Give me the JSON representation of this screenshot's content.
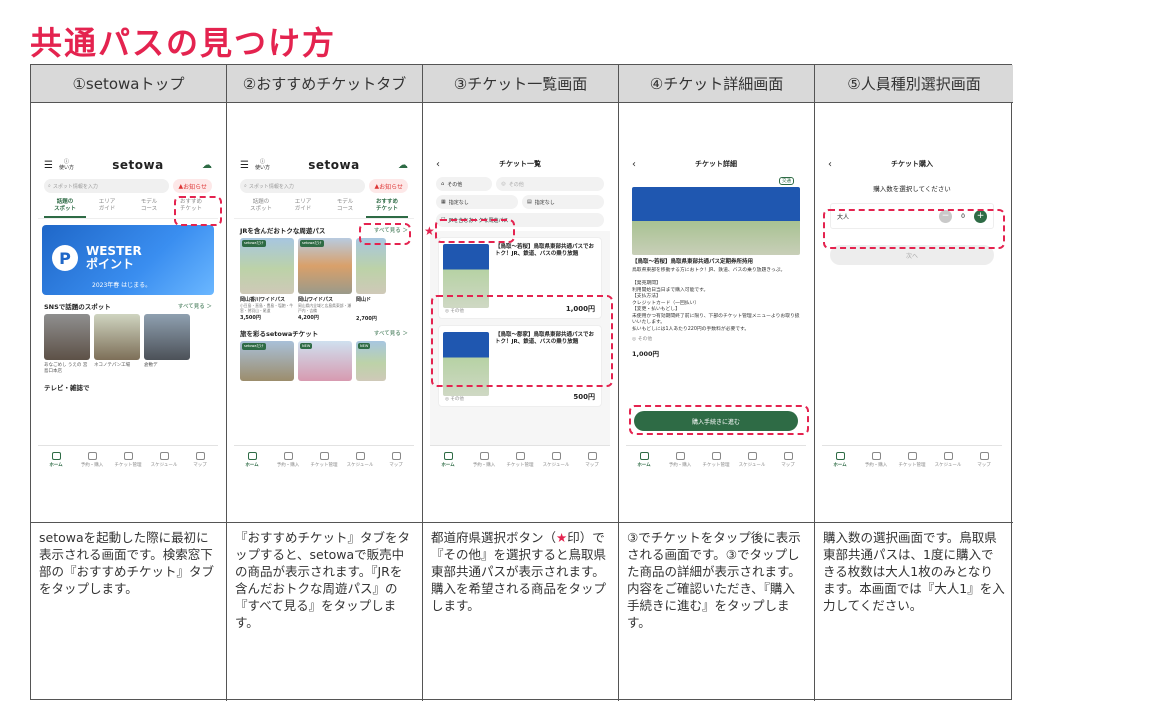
{
  "page_title": "共通パスの見つけ方",
  "columns": [
    {
      "header": "①setowaトップ",
      "description": "setowaを起動した際に最初に表示される画面です。検索窓下部の『おすすめチケット』タブをタップします。"
    },
    {
      "header": "②おすすめチケットタブ",
      "description": "『おすすめチケット』タブをタップすると、setowaで販売中の商品が表示されます。『JRを含んだおトクな周遊パス』の『すべて見る』をタップします。"
    },
    {
      "header": "③チケット一覧画面",
      "description_a": "都道府県選択ボタン（",
      "description_star": "★",
      "description_b": "印）で『その他』を選択すると鳥取県東部共通パスが表示されます。購入を希望される商品をタップします。"
    },
    {
      "header": "④チケット詳細画面",
      "description": "③でチケットをタップ後に表示される画面です。③でタップした商品の詳細が表示されます。内容をご確認いただき、『購入手続きに進む』をタップします。"
    },
    {
      "header": "⑤人員種別選択画面",
      "description": "購入数の選択画面です。鳥取県東部共通パスは、1度に購入できる枚数は大人1枚のみとなります。本画面では『大人1』を入力してください。"
    }
  ],
  "tabbar": [
    "ホーム",
    "予約・購入",
    "チケット管理",
    "スケジュール",
    "マップ"
  ],
  "screen1": {
    "logo": "setowa",
    "howto": "使い方",
    "search_placeholder": "スポット情報を入力",
    "notice": "お知らせ",
    "tabs": [
      "話題の\nスポット",
      "エリア\nガイド",
      "モデル\nコース",
      "おすすめ\nチケット"
    ],
    "banner_main": "WESTER\nポイント",
    "banner_sub": "2023年春 はじまる。",
    "section_title": "SNSで話題のスポット",
    "more": "すべて見る ＞",
    "captions": [
      "あなごめし うえの 宮島口本店",
      "ネコノテパン工場",
      "倉敷デ"
    ],
    "section2": "テレビ・雑誌で"
  },
  "screen2": {
    "logo": "setowa",
    "howto": "使い方",
    "search_placeholder": "スポット情報を入力",
    "notice": "お知らせ",
    "tabs": [
      "話題の\nスポット",
      "エリア\nガイド",
      "モデル\nコース",
      "おすすめ\nチケット"
    ],
    "section_title": "JRを含んだおトクな周遊パス",
    "more": "すべて見る ＞",
    "tag": "setowaだけ",
    "cards": [
      {
        "name": "岡山香川ワイドパス",
        "desc": "小豆島・直島・豊島・塩飽・牛窓・鷲羽山・尾道",
        "price": "3,500円"
      },
      {
        "name": "岡山ワイドパス",
        "desc": "岡山県内全域と広島県東部・瀬戸内・吉備",
        "price": "4,200円"
      },
      {
        "name": "岡山ド",
        "desc": "",
        "price": "2,700円"
      }
    ],
    "section2": "旅を彩るsetowaチケット",
    "more2": "すべて見る ＞",
    "new_tag": "NEW"
  },
  "screen3": {
    "title": "チケット一覧",
    "pref": "その他",
    "area_placeholder": "その他",
    "filter1": "指定なし",
    "filter2": "指定なし",
    "jr_filter": "JRを含むおトクな周遊パス",
    "card1_title": "【鳥取～若桜】鳥取県東部共通パスでおトク！JR、鉄道、バスの乗り放題",
    "card1_place": "その他",
    "card1_price": "1,000円",
    "card2_title": "【鳥取～郡家】鳥取県東部共通パスでおトク！JR、鉄道、バスの乗り放題",
    "card2_place": "その他",
    "card2_price": "500円"
  },
  "screen4": {
    "title": "チケット詳細",
    "badge": "交通",
    "ticket_title": "【鳥取～若桜】鳥取県東部共通パス定期券所持用",
    "body": "鳥取県東部を移動する方におトク！JR、鉄道、バスの乗り放題きっぷ。\n\n【発売期間】\n利用開始日当日まで購入可能です。\n【支払方法】\nクレジットカード（一回払い）\n【変更・払いもどし】\n未使用かつ有効期間終了前に限り、下部のチケット管理メニューよりお取り扱いいたします。\n払いもどしには1人あたり220円の手数料が必要です。",
    "place": "その他",
    "price": "1,000円",
    "button": "購入手続きに進む"
  },
  "screen5": {
    "title": "チケット購入",
    "prompt": "購入数を選択してください",
    "row_label": "大人",
    "qty": "0",
    "next": "次へ"
  }
}
